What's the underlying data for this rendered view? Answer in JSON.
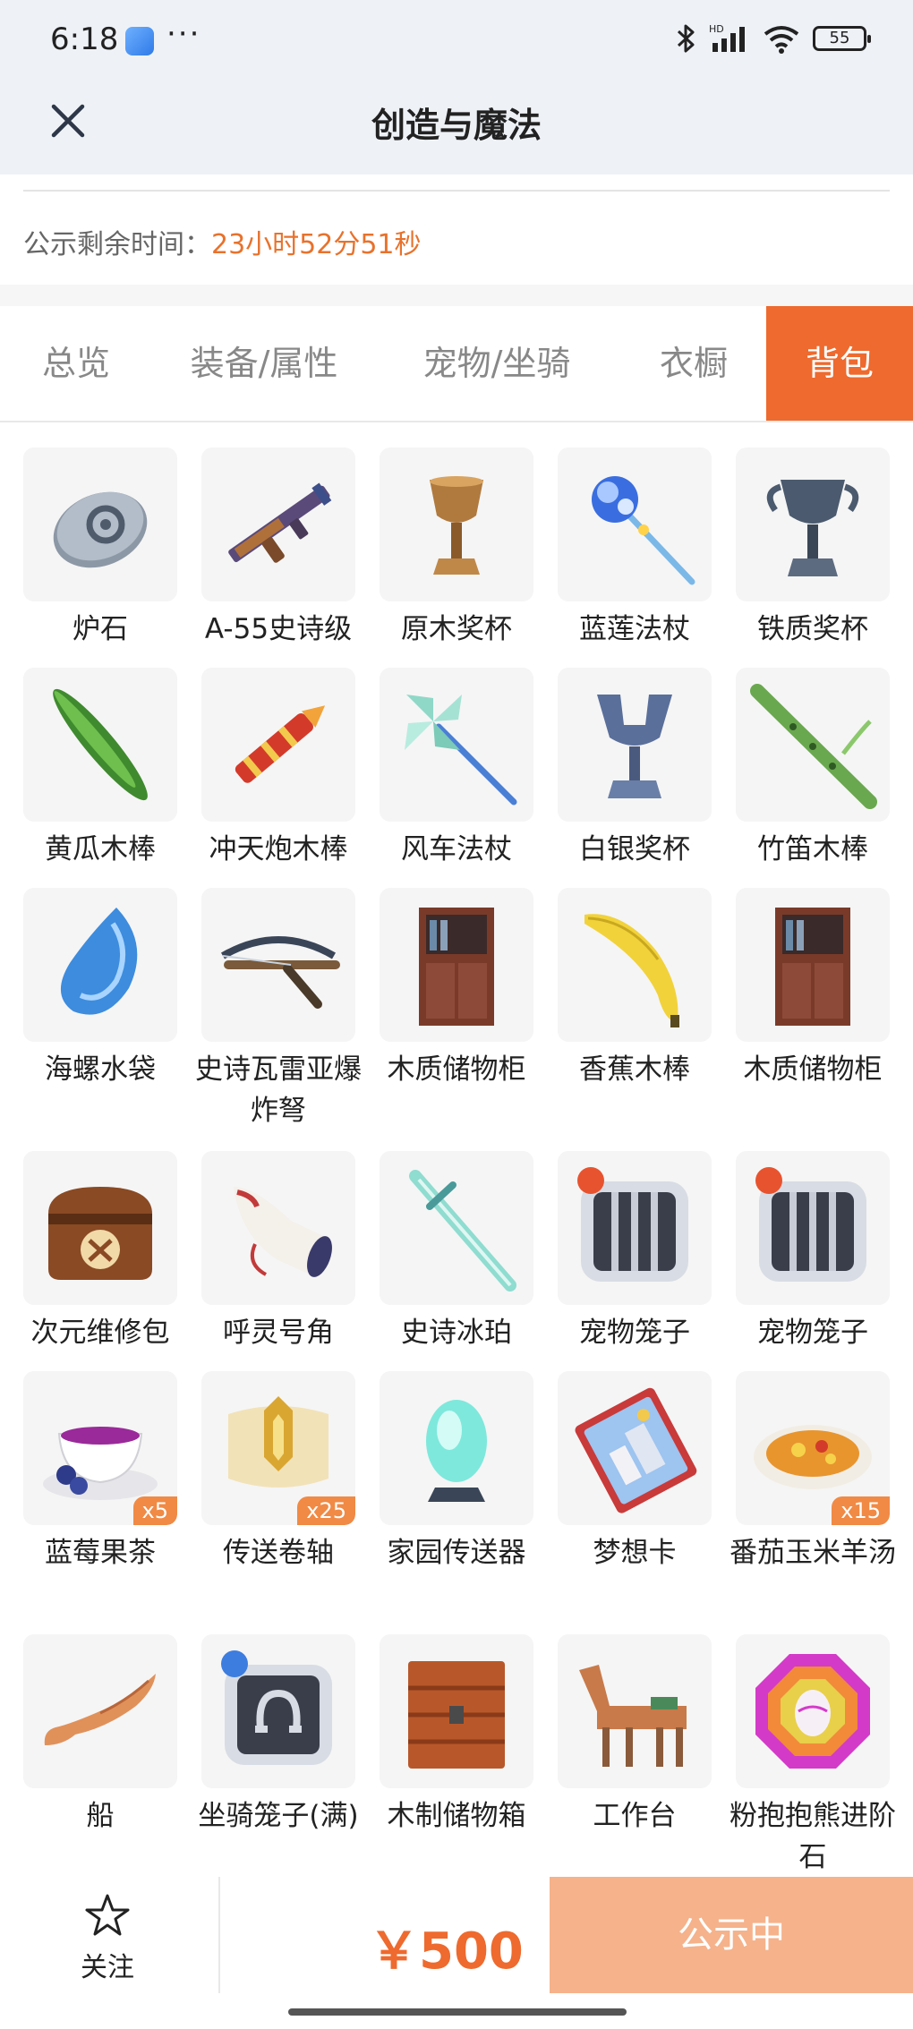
{
  "status_bar": {
    "time": "6:18",
    "more": "···",
    "battery": "55",
    "hd": "HD"
  },
  "header": {
    "title": "创造与魔法"
  },
  "notice": {
    "label": "公示剩余时间：",
    "value": "23小时52分51秒"
  },
  "tabs": [
    {
      "label": "总览"
    },
    {
      "label": "装备/属性"
    },
    {
      "label": "宠物/坐骑"
    },
    {
      "label": "衣橱"
    },
    {
      "label": "背包",
      "active": true
    }
  ],
  "items": [
    {
      "name": "炉石",
      "icon": "hearthstone-icon"
    },
    {
      "name": "A-55史诗级",
      "icon": "rifle-icon"
    },
    {
      "name": "原木奖杯",
      "icon": "wooden-trophy-icon"
    },
    {
      "name": "蓝莲法杖",
      "icon": "blue-lotus-staff-icon"
    },
    {
      "name": "铁质奖杯",
      "icon": "iron-trophy-icon"
    },
    {
      "name": "黄瓜木棒",
      "icon": "cucumber-club-icon"
    },
    {
      "name": "冲天炮木棒",
      "icon": "firework-club-icon"
    },
    {
      "name": "风车法杖",
      "icon": "pinwheel-staff-icon"
    },
    {
      "name": "白银奖杯",
      "icon": "silver-trophy-icon"
    },
    {
      "name": "竹笛木棒",
      "icon": "bamboo-flute-club-icon"
    },
    {
      "name": "海螺水袋",
      "icon": "conch-waterbag-icon"
    },
    {
      "name": "史诗瓦雷亚爆炸弩",
      "icon": "crossbow-icon"
    },
    {
      "name": "木质储物柜",
      "icon": "wooden-cabinet-icon"
    },
    {
      "name": "香蕉木棒",
      "icon": "banana-club-icon"
    },
    {
      "name": "木质储物柜",
      "icon": "wooden-cabinet-icon"
    },
    {
      "name": "次元维修包",
      "icon": "repair-bag-icon"
    },
    {
      "name": "呼灵号角",
      "icon": "horn-icon"
    },
    {
      "name": "史诗冰珀",
      "icon": "ice-sword-icon"
    },
    {
      "name": "宠物笼子",
      "icon": "pet-cage-icon"
    },
    {
      "name": "宠物笼子",
      "icon": "pet-cage-icon"
    },
    {
      "name": "蓝莓果茶",
      "icon": "blueberry-tea-icon",
      "qty": "x5"
    },
    {
      "name": "传送卷轴",
      "icon": "teleport-scroll-icon",
      "qty": "x25"
    },
    {
      "name": "家园传送器",
      "icon": "home-teleporter-icon"
    },
    {
      "name": "梦想卡",
      "icon": "dream-card-icon"
    },
    {
      "name": "番茄玉米羊汤",
      "icon": "tomato-corn-soup-icon",
      "qty": "x15"
    },
    {
      "name": "船",
      "icon": "boat-icon"
    },
    {
      "name": "坐骑笼子(满)",
      "icon": "mount-cage-icon"
    },
    {
      "name": "木制储物箱",
      "icon": "wooden-chest-icon"
    },
    {
      "name": "工作台",
      "icon": "workbench-horse-icon"
    },
    {
      "name": "粉抱抱熊进阶石",
      "icon": "pink-gem-icon"
    }
  ],
  "bottom_bar": {
    "follow_label": "关注",
    "price": "￥500",
    "status_button": "公示中"
  },
  "colors": {
    "accent": "#ee6a2e",
    "countdown": "#e8722c",
    "button_disabled": "#f5b28b",
    "badge": "#f08a45"
  }
}
